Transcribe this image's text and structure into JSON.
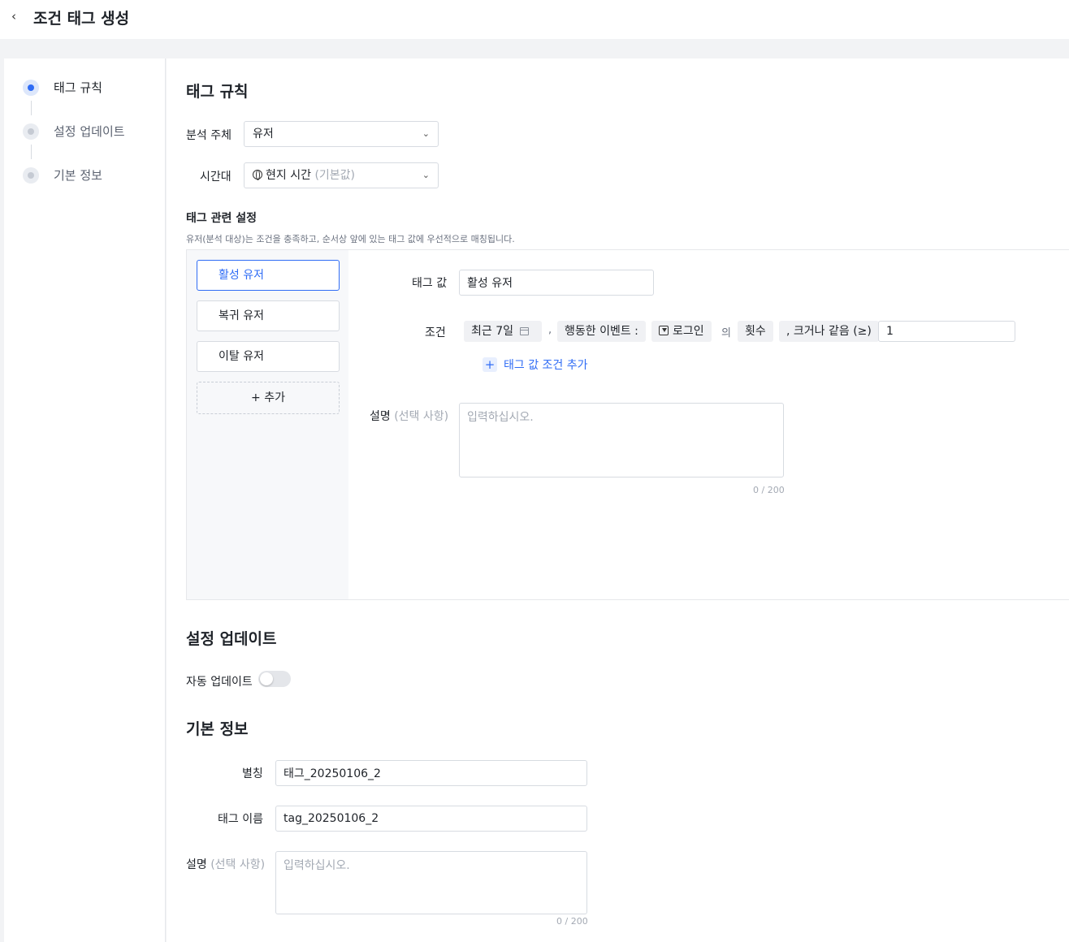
{
  "header": {
    "back_icon": "chevron-left-icon",
    "title": "조건 태그 생성"
  },
  "steps": [
    {
      "label": "태그 규칙",
      "active": true
    },
    {
      "label": "설정 업데이트",
      "active": false
    },
    {
      "label": "기본 정보",
      "active": false
    }
  ],
  "tag_rules": {
    "title": "태그 규칙",
    "subject_label": "분석 주체",
    "subject_value": "유저",
    "timezone_label": "시간대",
    "timezone_value": "현지 시간",
    "timezone_default": "(기본값)",
    "settings_title": "태그 관련 설정",
    "settings_desc": "유저(분석 대상)는 조건을 충족하고, 순서상 앞에 있는 태그 값에 우선적으로 매칭됩니다.",
    "tags": [
      "활성 유저",
      "복귀 유저",
      "이탈 유저"
    ],
    "add_tag_label": "+ 추가",
    "detail": {
      "tag_value_label": "태그 값",
      "tag_value": "활성 유저",
      "condition_label": "조건",
      "condition": {
        "period": "최근 7일",
        "comma": ",",
        "event_type": "행동한 이벤트 :",
        "event": "로그인",
        "of": "의",
        "metric": "횟수",
        "operator": ", 크거나 같음 (≥)",
        "value": "1"
      },
      "add_condition_label": "태그 값 조건 추가",
      "desc_label": "설명",
      "desc_optional": "(선택 사항)",
      "desc_placeholder": "입력하십시오.",
      "desc_counter": "0 / 200"
    }
  },
  "update_settings": {
    "title": "설정 업데이트",
    "auto_update_label": "자동 업데이트",
    "auto_update_on": false
  },
  "basic_info": {
    "title": "기본 정보",
    "alias_label": "별칭",
    "alias_value": "태그_20250106_2",
    "name_label": "태그 이름",
    "name_value": "tag_20250106_2",
    "desc_label": "설명",
    "desc_optional": "(선택 사항)",
    "desc_placeholder": "입력하십시오.",
    "desc_counter": "0 / 200"
  }
}
